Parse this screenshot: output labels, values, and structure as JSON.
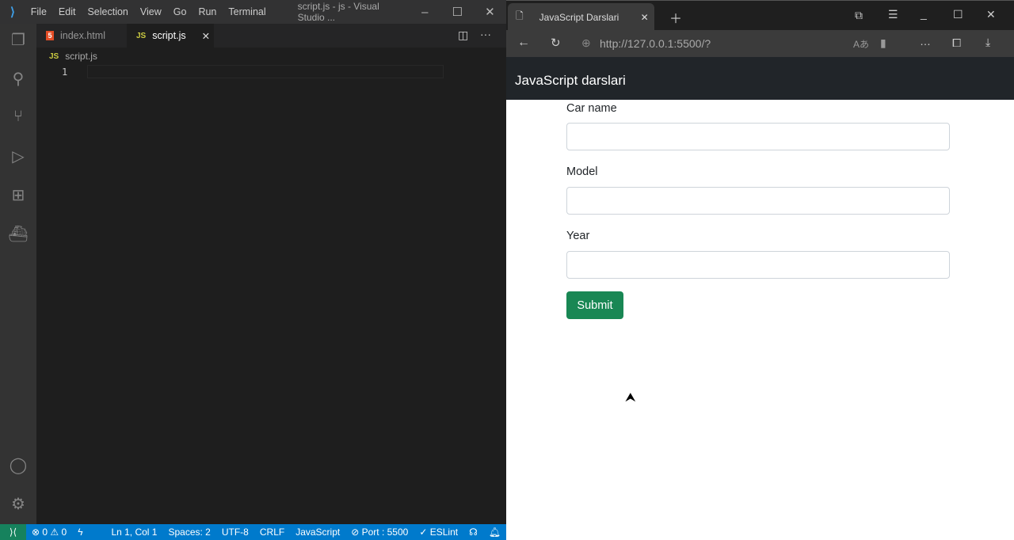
{
  "vscode": {
    "menu": [
      "File",
      "Edit",
      "Selection",
      "View",
      "Go",
      "Run",
      "Terminal"
    ],
    "window_title": "script.js - js - Visual Studio ...",
    "tabs": [
      {
        "label": "index.html",
        "icon": "html5-icon"
      },
      {
        "label": "script.js",
        "icon": "js-icon",
        "active": true
      }
    ],
    "breadcrumb": "script.js",
    "line_numbers": [
      "1"
    ],
    "status": {
      "errors": "0",
      "warnings": "0",
      "position": "Ln 1, Col 1",
      "spaces": "Spaces: 2",
      "encoding": "UTF-8",
      "eol": "CRLF",
      "language": "JavaScript",
      "port": "Port : 5500",
      "eslint": "ESLint"
    },
    "colors": {
      "status_bar": "#007acc",
      "remote": "#16825d"
    }
  },
  "browser": {
    "tab_title": "JavaScript Darslari",
    "url": "http://127.0.0.1:5500/?",
    "page": {
      "brand": "JavaScript darslari",
      "fields": [
        {
          "label": "Car name",
          "value": ""
        },
        {
          "label": "Model",
          "value": ""
        },
        {
          "label": "Year",
          "value": ""
        }
      ],
      "submit_label": "Submit"
    },
    "colors": {
      "submit": "#198754",
      "navbar": "#212529"
    }
  }
}
